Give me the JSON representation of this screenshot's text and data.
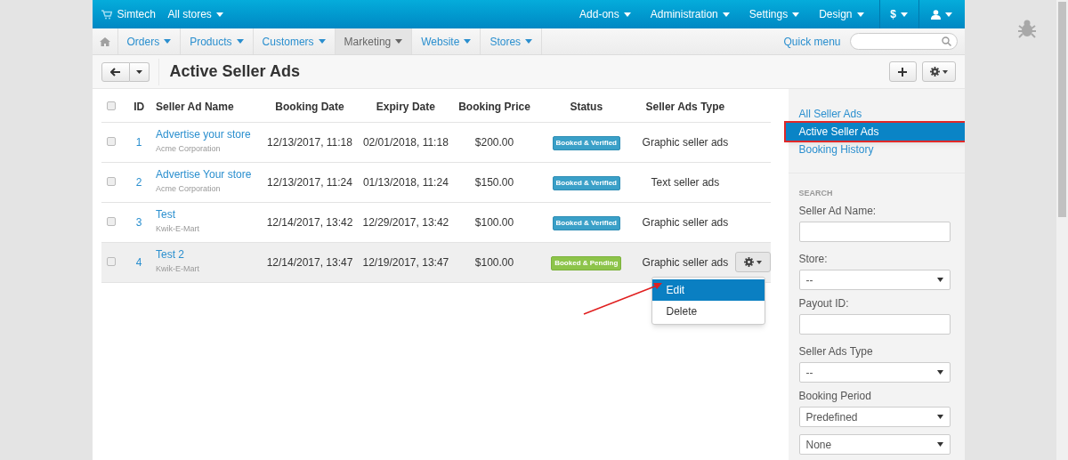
{
  "topbar": {
    "brand": "Simtech",
    "store_switcher": "All stores",
    "menus": [
      "Add-ons",
      "Administration",
      "Settings",
      "Design"
    ],
    "currency": "$"
  },
  "nav": {
    "items": [
      {
        "label": "Orders",
        "selected": false
      },
      {
        "label": "Products",
        "selected": false
      },
      {
        "label": "Customers",
        "selected": false
      },
      {
        "label": "Marketing",
        "selected": true
      },
      {
        "label": "Website",
        "selected": false
      },
      {
        "label": "Stores",
        "selected": false
      }
    ],
    "quick_menu": "Quick menu"
  },
  "page_title": "Active Seller Ads",
  "table": {
    "select_all_checked": false,
    "columns": [
      "ID",
      "Seller Ad Name",
      "Booking Date",
      "Expiry Date",
      "Booking Price",
      "Status",
      "Seller Ads Type"
    ],
    "rows": [
      {
        "checked": false,
        "highlighted": false,
        "id": "1",
        "name": "Advertise your store",
        "company": "Acme Corporation",
        "booking_date": "12/13/2017, 11:18",
        "expiry_date": "02/01/2018, 11:18",
        "price": "$200.00",
        "status": {
          "label": "Booked & Verified",
          "kind": "verified"
        },
        "type": "Graphic seller ads"
      },
      {
        "checked": false,
        "highlighted": false,
        "id": "2",
        "name": "Advertise Your store",
        "company": "Acme Corporation",
        "booking_date": "12/13/2017, 11:24",
        "expiry_date": "01/13/2018, 11:24",
        "price": "$150.00",
        "status": {
          "label": "Booked & Verified",
          "kind": "verified"
        },
        "type": "Text seller ads"
      },
      {
        "checked": false,
        "highlighted": false,
        "id": "3",
        "name": "Test",
        "company": "Kwik-E-Mart",
        "booking_date": "12/14/2017, 13:42",
        "expiry_date": "12/29/2017, 13:42",
        "price": "$100.00",
        "status": {
          "label": "Booked & Verified",
          "kind": "verified"
        },
        "type": "Graphic seller ads"
      },
      {
        "checked": false,
        "highlighted": true,
        "id": "4",
        "name": "Test 2",
        "company": "Kwik-E-Mart",
        "booking_date": "12/14/2017, 13:47",
        "expiry_date": "12/19/2017, 13:47",
        "price": "$100.00",
        "status": {
          "label": "Booked & Pending",
          "kind": "pending"
        },
        "type": "Graphic seller ads",
        "actions_menu": [
          {
            "label": "Edit",
            "selected": true
          },
          {
            "label": "Delete",
            "selected": false
          }
        ]
      }
    ]
  },
  "sidebar": {
    "links": [
      {
        "label": "All Seller Ads",
        "selected": false
      },
      {
        "label": "Active Seller Ads",
        "selected": true
      },
      {
        "label": "Booking History",
        "selected": false
      }
    ],
    "search_title": "SEARCH",
    "fields": [
      {
        "label": "Seller Ad Name:",
        "kind": "text"
      },
      {
        "label": "Store:",
        "kind": "select",
        "value": "--"
      },
      {
        "label": "Payout ID:",
        "kind": "text"
      },
      {
        "label": "Seller Ads Type",
        "kind": "select",
        "value": "--"
      },
      {
        "label": "Booking Period",
        "kind": "select",
        "value": "Predefined"
      },
      {
        "kind": "select",
        "value": "None"
      }
    ]
  }
}
